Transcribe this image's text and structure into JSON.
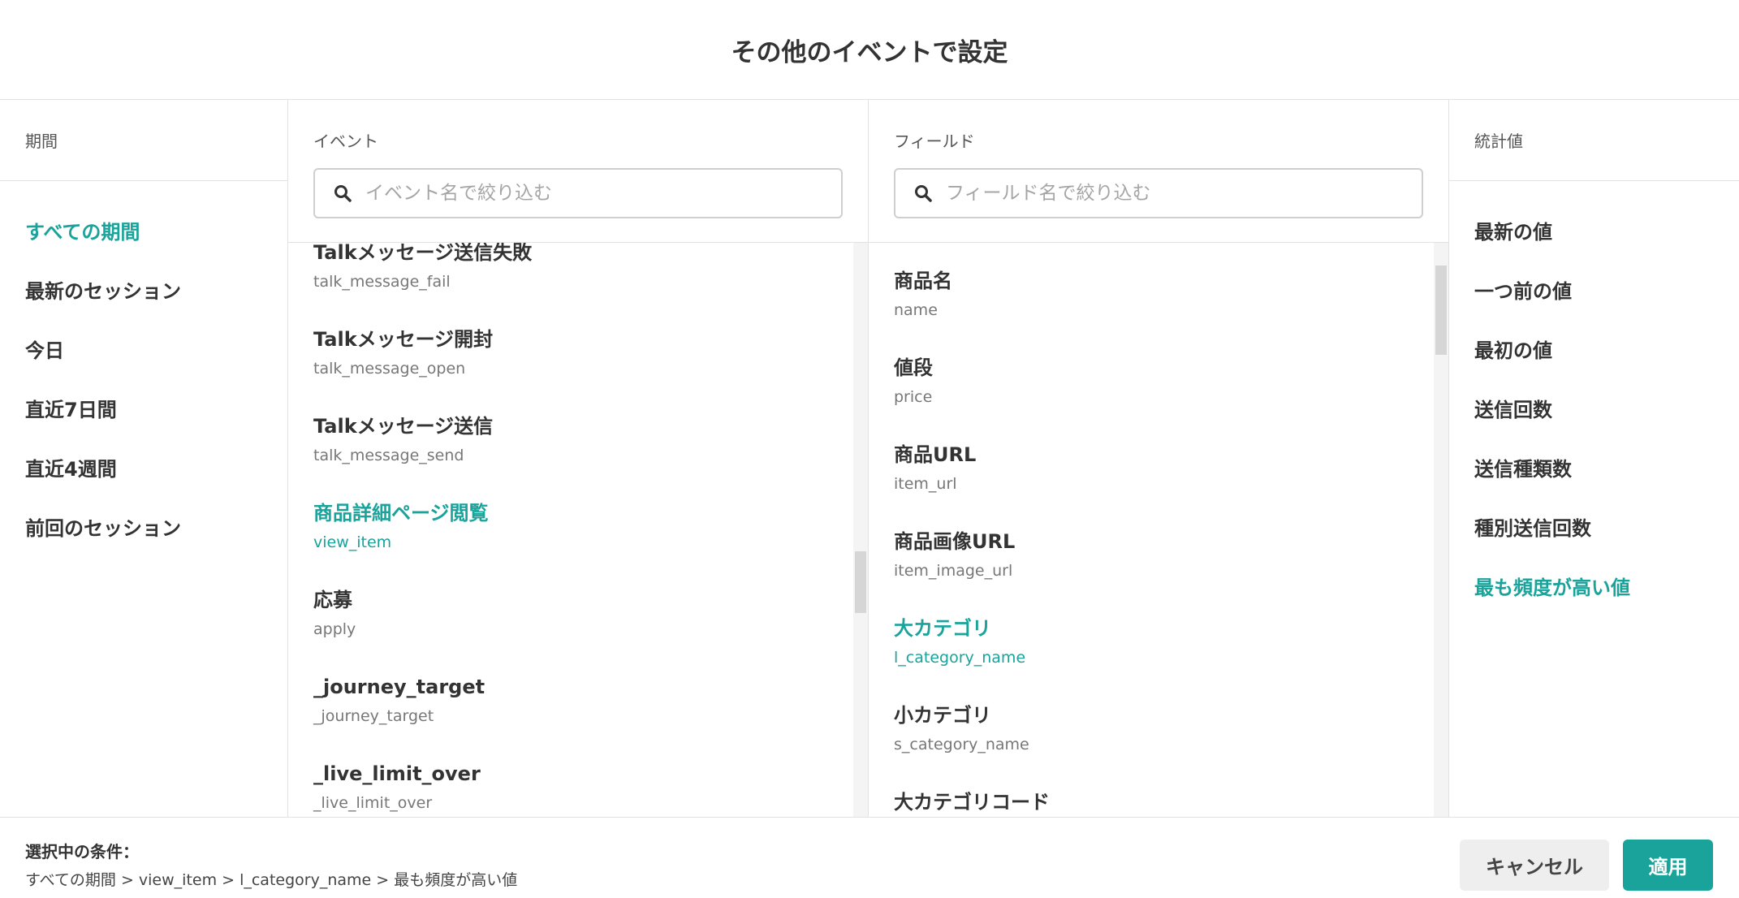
{
  "dialog": {
    "title": "その他のイベントで設定"
  },
  "period": {
    "heading": "期間",
    "items": [
      {
        "label": "すべての期間",
        "selected": true
      },
      {
        "label": "最新のセッション",
        "selected": false
      },
      {
        "label": "今日",
        "selected": false
      },
      {
        "label": "直近7日間",
        "selected": false
      },
      {
        "label": "直近4週間",
        "selected": false
      },
      {
        "label": "前回のセッション",
        "selected": false
      }
    ]
  },
  "event": {
    "heading": "イベント",
    "search_placeholder": "イベント名で絞り込む",
    "items": [
      {
        "name": "Talkメッセージ送信失敗",
        "key": "talk_message_fail",
        "selected": false
      },
      {
        "name": "Talkメッセージ開封",
        "key": "talk_message_open",
        "selected": false
      },
      {
        "name": "Talkメッセージ送信",
        "key": "talk_message_send",
        "selected": false
      },
      {
        "name": "商品詳細ページ閲覧",
        "key": "view_item",
        "selected": true
      },
      {
        "name": "応募",
        "key": "apply",
        "selected": false
      },
      {
        "name": "_journey_target",
        "key": "_journey_target",
        "selected": false
      },
      {
        "name": "_live_limit_over",
        "key": "_live_limit_over",
        "selected": false
      }
    ]
  },
  "field": {
    "heading": "フィールド",
    "search_placeholder": "フィールド名で絞り込む",
    "items": [
      {
        "name": "商品名",
        "key": "name",
        "selected": false
      },
      {
        "name": "値段",
        "key": "price",
        "selected": false
      },
      {
        "name": "商品URL",
        "key": "item_url",
        "selected": false
      },
      {
        "name": "商品画像URL",
        "key": "item_image_url",
        "selected": false
      },
      {
        "name": "大カテゴリ",
        "key": "l_category_name",
        "selected": true
      },
      {
        "name": "小カテゴリ",
        "key": "s_category_name",
        "selected": false
      },
      {
        "name": "大カテゴリコード",
        "key": "",
        "selected": false
      }
    ]
  },
  "stat": {
    "heading": "統計値",
    "items": [
      {
        "label": "最新の値",
        "selected": false
      },
      {
        "label": "一つ前の値",
        "selected": false
      },
      {
        "label": "最初の値",
        "selected": false
      },
      {
        "label": "送信回数",
        "selected": false
      },
      {
        "label": "送信種類数",
        "selected": false
      },
      {
        "label": "種別送信回数",
        "selected": false
      },
      {
        "label": "最も頻度が高い値",
        "selected": true
      }
    ]
  },
  "footer": {
    "selected_label": "選択中の条件：",
    "selected_value": "すべての期間 > view_item > l_category_name > 最も頻度が高い値",
    "cancel_label": "キャンセル",
    "apply_label": "適用"
  },
  "colors": {
    "accent": "#1aa39a",
    "text": "#333333",
    "border": "#e2e2e2"
  }
}
